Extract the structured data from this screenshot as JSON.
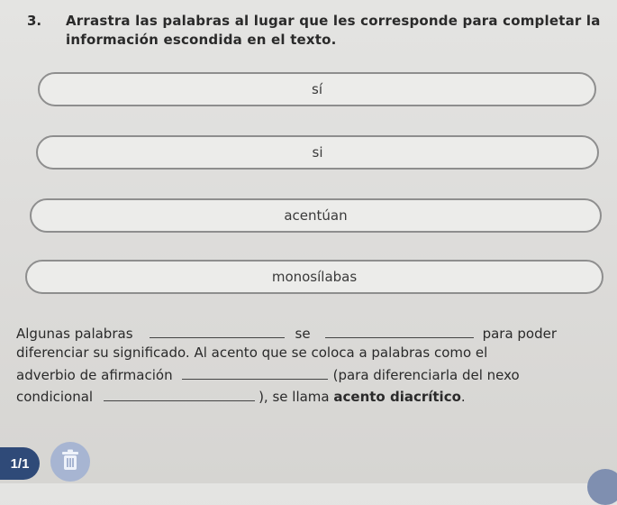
{
  "question": {
    "number": "3.",
    "instruction": "Arrastra las palabras al lugar que les corresponde para completar la información escondida en el texto."
  },
  "word_bank": [
    {
      "label": "sí"
    },
    {
      "label": "si"
    },
    {
      "label": "acentúan"
    },
    {
      "label": "monosílabas"
    }
  ],
  "sentence": {
    "seg1": "Algunas palabras",
    "seg2": "se",
    "seg3": "para poder",
    "seg4": "diferenciar su significado. Al acento que se coloca a palabras como el",
    "seg5": "adverbio de afirmación",
    "seg6": "(para diferenciarla del nexo",
    "seg7": "condicional",
    "seg8": "), se llama ",
    "seg9": "acento diacrítico",
    "seg10": "."
  },
  "footer": {
    "page_indicator": "1/1",
    "trash_icon": "trash-icon"
  },
  "colors": {
    "badge": "#2f4a78",
    "trash_button": "#a7b5d2",
    "card_border": "#8e8e8e"
  }
}
